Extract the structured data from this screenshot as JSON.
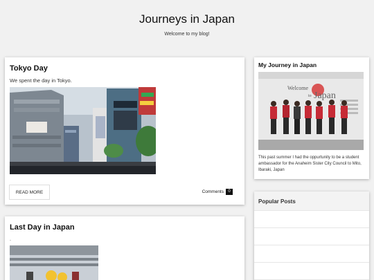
{
  "header": {
    "title": "Journeys in Japan",
    "description": "Welcome to my blog!"
  },
  "posts": [
    {
      "title": "Tokyo Day",
      "excerpt": "We spent the day in Tokyo.",
      "read_more": "READ MORE",
      "comments_label": "Comments",
      "comments_count": "0"
    },
    {
      "title": "Last Day in Japan",
      "excerpt": "."
    }
  ],
  "sidebar": {
    "journey": {
      "title": "My Journey in Japan",
      "text": "This past summer I had the oppurtunity to be a student ambassador for the Anaheim Sister City Council to Mito, Ibaraki, Japan",
      "sign_text": "Welcome to Japan"
    },
    "popular": {
      "title": "Popular Posts"
    }
  },
  "colors": {
    "background": "#f1f1f1",
    "card": "#ffffff",
    "badge": "#111111"
  }
}
